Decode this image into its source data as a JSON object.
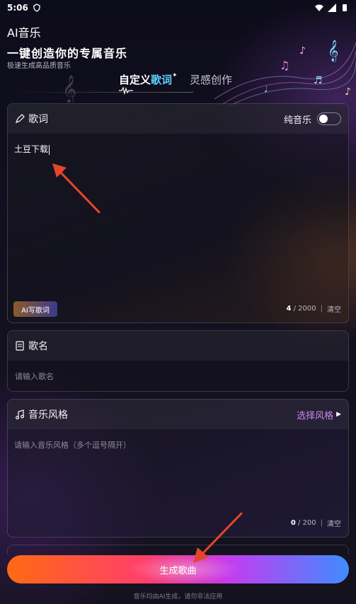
{
  "status_bar": {
    "time": "5:06"
  },
  "app": {
    "title": "AI音乐",
    "hero_title": "一键创造你的专属音乐",
    "hero_subtitle": "极速生成高品质音乐"
  },
  "tabs": [
    {
      "label_a": "自定义",
      "label_b": "歌词",
      "active": true
    },
    {
      "label": "灵感创作",
      "active": false
    }
  ],
  "lyrics": {
    "header": "歌词",
    "toggle_label": "纯音乐",
    "toggle_on": false,
    "value": "土豆下载",
    "ai_button": "AI写歌词",
    "count": "4",
    "max": "/ 2000",
    "clear": "清空"
  },
  "song_name": {
    "header": "歌名",
    "placeholder": "请输入歌名"
  },
  "music_style": {
    "header": "音乐风格",
    "choose": "选择风格",
    "placeholder": "请输入音乐风格（多个逗号隔开）",
    "count": "0",
    "max": "/ 200",
    "clear": "清空"
  },
  "generate_button": "生成歌曲",
  "disclaimer": "音乐均由AI生成，请勿非法应用",
  "colors": {
    "accent_blue": "#5fd0ff",
    "accent_purple": "#c88af0",
    "arrow_red": "#e5462a"
  }
}
